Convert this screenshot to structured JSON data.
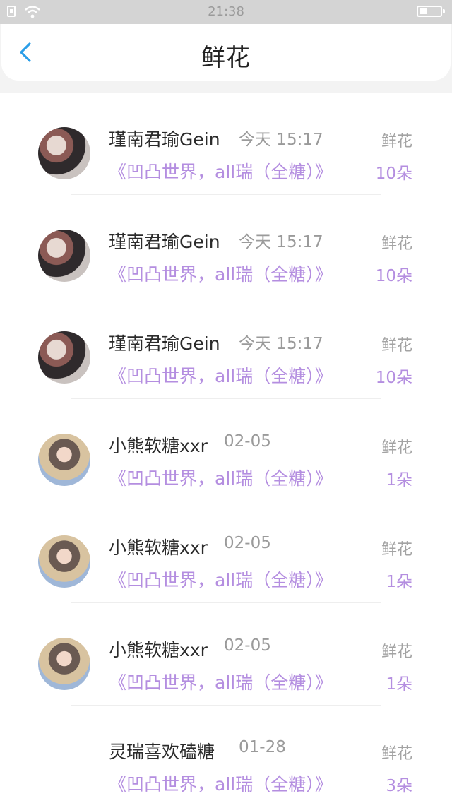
{
  "status_bar": {
    "time": "21:38"
  },
  "header": {
    "title": "鲜花"
  },
  "records": [
    {
      "user": "瑾南君瑜Gein",
      "time": "今天 15:17",
      "type": "鲜花",
      "book": "《凹凸世界，all瑞（全糖）》",
      "count": "10朵"
    },
    {
      "user": "瑾南君瑜Gein",
      "time": "今天 15:17",
      "type": "鲜花",
      "book": "《凹凸世界，all瑞（全糖）》",
      "count": "10朵"
    },
    {
      "user": "瑾南君瑜Gein",
      "time": "今天 15:17",
      "type": "鲜花",
      "book": "《凹凸世界，all瑞（全糖）》",
      "count": "10朵"
    },
    {
      "user": "小熊软糖xxr",
      "time": "02-05",
      "type": "鲜花",
      "book": "《凹凸世界，all瑞（全糖）》",
      "count": "1朵"
    },
    {
      "user": "小熊软糖xxr",
      "time": "02-05",
      "type": "鲜花",
      "book": "《凹凸世界，all瑞（全糖）》",
      "count": "1朵"
    },
    {
      "user": "小熊软糖xxr",
      "time": "02-05",
      "type": "鲜花",
      "book": "《凹凸世界，all瑞（全糖）》",
      "count": "1朵"
    },
    {
      "user": "灵瑞喜欢磕糖",
      "time": "01-28",
      "type": "鲜花",
      "book": "《凹凸世界，all瑞（全糖）》",
      "count": "3朵"
    }
  ]
}
